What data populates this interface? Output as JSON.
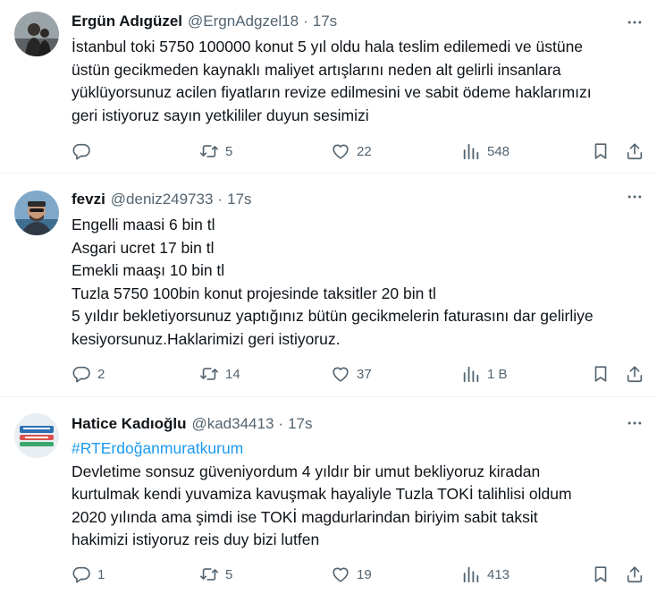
{
  "tweets": [
    {
      "name": "Ergün Adıgüzel",
      "handle": "@ErgnAdgzel18",
      "dot": "·",
      "time": "17s",
      "lines": [
        "İstanbul toki 5750 100000 konut 5 yıl oldu hala teslim edilemedi ve üstüne",
        "üstün gecikmeden kaynaklı maliyet artışlarını neden alt gelirli insanlara",
        "yüklüyorsunuz acilen fiyatların revize edilmesini ve sabit ödeme haklarımızı",
        "geri istiyoruz sayın yetkililer duyun sesimizi"
      ],
      "replies": "",
      "retweets": "5",
      "likes": "22",
      "views": "548"
    },
    {
      "name": "fevzi",
      "handle": "@deniz249733",
      "dot": "·",
      "time": "17s",
      "lines": [
        "Engelli maasi 6 bin tl",
        "Asgari ucret 17 bin tl",
        "Emekli maaşı 10 bin tl",
        "Tuzla 5750 100bin konut projesinde taksitler 20 bin tl",
        "5 yıldır bekletiyorsunuz yaptığınız bütün gecikmelerin faturasını dar gelirliye",
        "kesiyorsunuz.Haklarimizi geri istiyoruz."
      ],
      "replies": "2",
      "retweets": "14",
      "likes": "37",
      "views": "1 B"
    },
    {
      "name": "Hatice Kadıoğlu",
      "handle": "@kad34413",
      "dot": "·",
      "time": "17s",
      "hashtag": "#RTErdoğanmuratkurum",
      "lines": [
        "Devletime sonsuz güveniyordum 4 yıldır bir umut bekliyoruz kiradan",
        "kurtulmak kendi yuvamiza kavuşmak hayaliyle Tuzla TOKİ talihlisi oldum",
        "2020 yılında ama şimdi ise TOKİ magdurlarindan biriyim sabit taksit",
        "hakimizi istiyoruz reis duy bizi lutfen"
      ],
      "replies": "1",
      "retweets": "5",
      "likes": "19",
      "views": "413"
    }
  ],
  "icons": {
    "reply": "reply-icon",
    "retweet": "retweet-icon",
    "like": "heart-icon",
    "views": "views-icon",
    "bookmark": "bookmark-icon",
    "share": "share-icon",
    "more": "more-icon"
  },
  "colors": {
    "text": "#0f1419",
    "secondary": "#536471",
    "link": "#1d9bf0",
    "divider": "#eff3f4"
  }
}
